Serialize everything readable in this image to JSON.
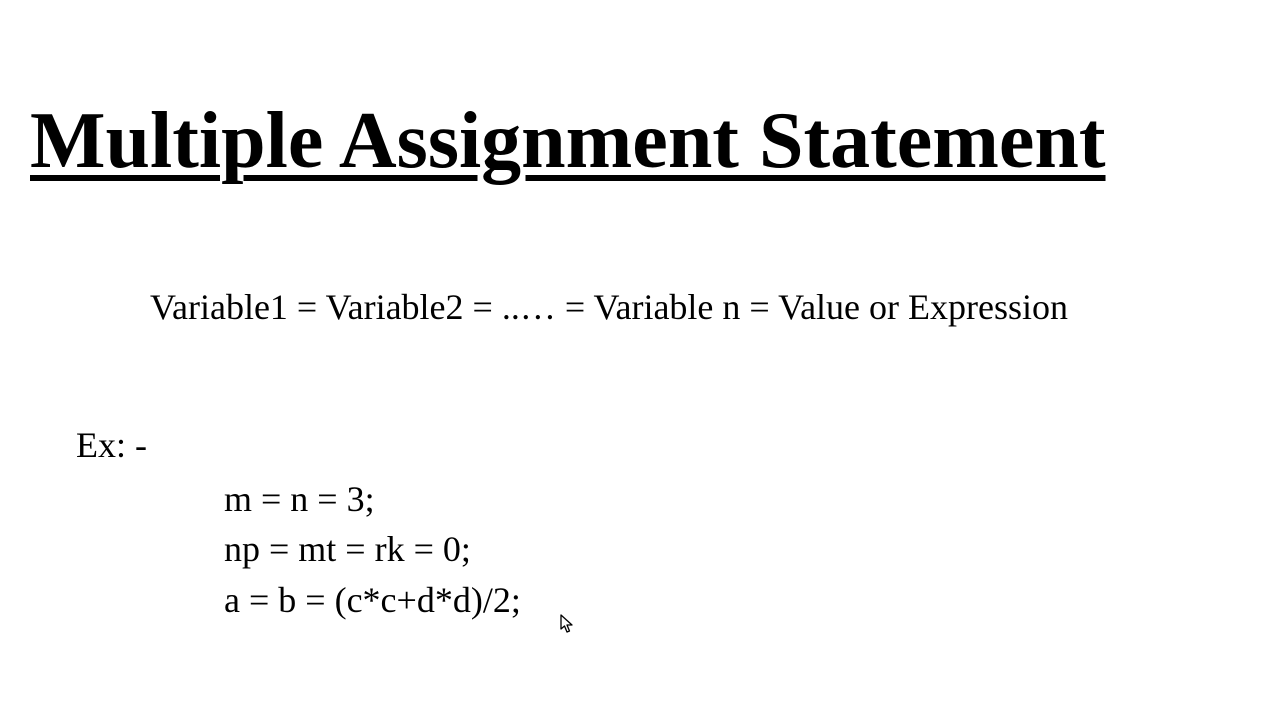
{
  "title": "Multiple Assignment Statement",
  "syntax": "Variable1 = Variable2 = ..… = Variable n = Value or Expression",
  "example_label": "Ex: -",
  "examples": {
    "line1": "m = n = 3;",
    "line2": "np = mt = rk = 0;",
    "line3": "a = b = (c*c+d*d)/2;"
  }
}
